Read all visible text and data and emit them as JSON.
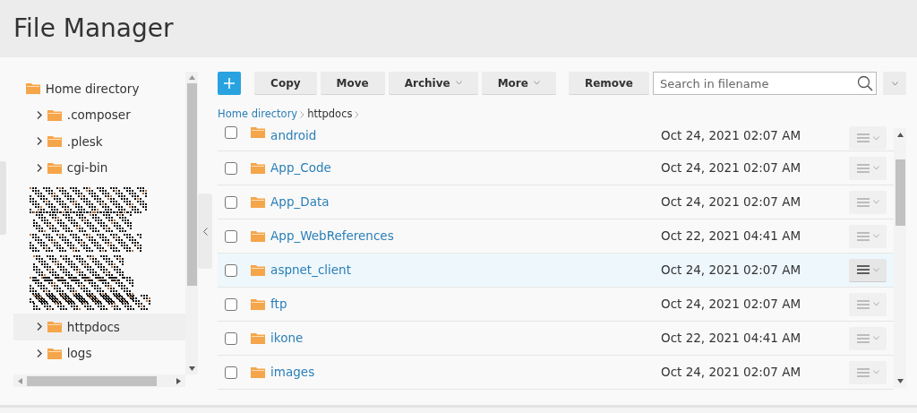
{
  "title": "File Manager",
  "tree": {
    "label": "Home directory",
    "children": [
      {
        "label": ".composer",
        "selected": false
      },
      {
        "label": ".plesk",
        "selected": false
      },
      {
        "label": "cgi-bin",
        "selected": false
      },
      {
        "kind": "redacted"
      },
      {
        "label": "httpdocs",
        "selected": true
      },
      {
        "label": "logs",
        "selected": false
      }
    ]
  },
  "toolbar": {
    "buttons": [
      {
        "label": "Copy",
        "dropdown": false
      },
      {
        "label": "Move",
        "dropdown": false
      },
      {
        "label": "Archive",
        "dropdown": true
      },
      {
        "label": "More",
        "dropdown": true
      },
      {
        "label": "Remove",
        "dropdown": false
      }
    ],
    "search": {
      "placeholder": "Search in filename"
    }
  },
  "breadcrumb": [
    "Home directory",
    "httpdocs"
  ],
  "files": [
    {
      "name": "android",
      "modified": "Oct 24, 2021 02:07 AM",
      "checked": false,
      "highlighted": false
    },
    {
      "name": "App_Code",
      "modified": "Oct 24, 2021 02:07 AM",
      "checked": false,
      "highlighted": false
    },
    {
      "name": "App_Data",
      "modified": "Oct 24, 2021 02:07 AM",
      "checked": false,
      "highlighted": false
    },
    {
      "name": "App_WebReferences",
      "modified": "Oct 22, 2021 04:41 AM",
      "checked": false,
      "highlighted": false
    },
    {
      "name": "aspnet_client",
      "modified": "Oct 24, 2021 02:07 AM",
      "checked": false,
      "highlighted": true
    },
    {
      "name": "ftp",
      "modified": "Oct 24, 2021 02:07 AM",
      "checked": false,
      "highlighted": false
    },
    {
      "name": "ikone",
      "modified": "Oct 22, 2021 04:41 AM",
      "checked": false,
      "highlighted": false
    },
    {
      "name": "images",
      "modified": "Oct 24, 2021 02:07 AM",
      "checked": false,
      "highlighted": false
    }
  ]
}
